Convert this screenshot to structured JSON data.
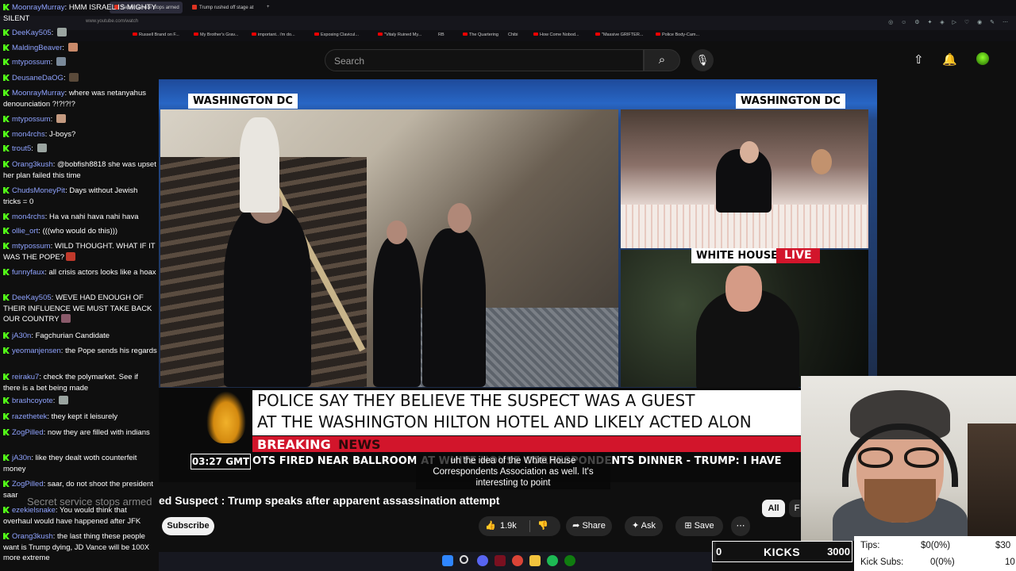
{
  "browser": {
    "tabs": [
      {
        "label": "Secret service stops armed",
        "active": true
      },
      {
        "label": "Trump rushed off stage at",
        "active": false
      }
    ],
    "url": "www.youtube.com/watch",
    "bookmarks": [
      "Russell Brand on F...",
      "My Brother's Grav...",
      "important.. i'm do...",
      "Exposing Clavicul...",
      "\"Vitaly Ruined My...",
      "RB",
      "The Quartering",
      "Chibi",
      "How Come Nobod...",
      "\"Massive GRIFTER...",
      "Police Body-Cam..."
    ]
  },
  "youtube": {
    "search_placeholder": "Search",
    "search_icon": "search-icon",
    "mic_icon": "mic-icon",
    "upload_icon": "upload-icon",
    "bell_icon": "bell-icon",
    "video_title": "ed Suspect : Trump speaks after apparent assassination attempt",
    "title_overlay": "Secret service stops armed",
    "subscribe_label": "Subscribe",
    "like_count": "1.9k",
    "share_label": "Share",
    "ask_label": "Ask",
    "save_label": "Save",
    "chip_all": "All",
    "chip_next": "F"
  },
  "broadcast": {
    "loc_left": "WASHINGTON DC",
    "loc_right": "WASHINGTON DC",
    "white_house": "WHITE HOUSE",
    "live": "LIVE",
    "headline_line1": "POLICE SAY THEY BELIEVE THE SUSPECT WAS A GUEST",
    "headline_line2": "AT THE WASHINGTON HILTON HOTEL AND LIKELY ACTED ALON",
    "breaking": "BREAKING",
    "news": "NEWS",
    "clock": "03:27  GMT",
    "ticker": "OTS FIRED NEAR BALLROOM AT WHITE HOUSE CORRESPONDENTS DINNER   -   TRUMP: I HAVE",
    "caption": "uh the idea of the White House Correspondents Association as well. It's interesting to point"
  },
  "chat": [
    {
      "user": "MoonrayMurray",
      "text": "HMM ISRAEL IS MIGHTY SILENT",
      "emote": ""
    },
    {
      "user": "DeeKay505",
      "text": "",
      "emote": "#9aa4a0"
    },
    {
      "user": "MaldingBeaver",
      "text": "",
      "emote": "#c98a6a"
    },
    {
      "user": "mtypossum",
      "text": "",
      "emote": "#7a8a9a"
    },
    {
      "user": "DeusaneDaOG",
      "text": "",
      "emote": "#5a4a3a"
    },
    {
      "user": "MoonrayMurray",
      "text": "where was netanyahus denounciation ?!?!?!?",
      "emote": ""
    },
    {
      "user": "mtypossum",
      "text": "",
      "emote": "#c49a80"
    },
    {
      "user": "mon4rchs",
      "text": "J-boys?",
      "emote": ""
    },
    {
      "user": "trout5",
      "text": "",
      "emote": "#9aa4a0"
    },
    {
      "user": "Orang3kush",
      "text": "@bobfish8818 she was upset her plan failed this time",
      "emote": ""
    },
    {
      "user": "ChudsMoneyPit",
      "text": "Days without Jewish tricks = 0",
      "emote": ""
    },
    {
      "user": "mon4rchs",
      "text": "Ha va nahi hava nahi hava",
      "emote": ""
    },
    {
      "user": "ollie_ort",
      "text": "(((who would do this)))",
      "emote": ""
    },
    {
      "user": "mtypossum",
      "text": "WILD THOUGHT. WHAT IF IT WAS THE POPE?",
      "emote": "#c0392b"
    },
    {
      "user": "funnyfaux",
      "text": "all crisis actors looks like a hoax",
      "emote": ""
    },
    {
      "user": "DeeKay505",
      "text": "WEVE HAD ENOUGH OF THEIR INFLUENCE WE MUST TAKE BACK OUR COUNTRY",
      "emote": "#8a5a6a"
    },
    {
      "user": "jA30n",
      "text": "Fagchurian Candidate",
      "emote": ""
    },
    {
      "user": "yeomanjensen",
      "text": "the Pope sends his regards",
      "emote": ""
    },
    {
      "user": "reiraku7",
      "text": "check the polymarket. See if there is a bet being made",
      "emote": ""
    },
    {
      "user": "brashcoyote",
      "text": "",
      "emote": "#9aa4a0"
    },
    {
      "user": "razethetek",
      "text": "they kept it leisurely",
      "emote": ""
    },
    {
      "user": "ZogPilled",
      "text": "now they are filled with indians",
      "emote": ""
    },
    {
      "user": "jA30n",
      "text": "like they dealt woth counterfeit money",
      "emote": ""
    },
    {
      "user": "ZogPilled",
      "text": "saar, do not shoot the president saar",
      "emote": ""
    },
    {
      "user": "ezekielsnake",
      "text": "You would think that overhaul would have happened after JFK",
      "emote": ""
    },
    {
      "user": "Orang3kush",
      "text": "the last thing these people want is Trump dying, JD Vance will be 100X more extreme",
      "emote": ""
    }
  ],
  "stream": {
    "kicks_current": "0",
    "kicks_label": "KICKS",
    "kicks_goal": "3000",
    "kicks_progress": 0.02,
    "tips_label": "Tips:",
    "tips_value": "$0(0%)",
    "tips_goal": "$30",
    "subs_label": "Kick Subs:",
    "subs_value": "0(0%)",
    "subs_goal": "10"
  },
  "colors": {
    "kick_green": "#53fc18",
    "chat_user": "#8fa3ff",
    "breaking_red": "#d2152b",
    "yt_bg": "#0f0f0f"
  }
}
